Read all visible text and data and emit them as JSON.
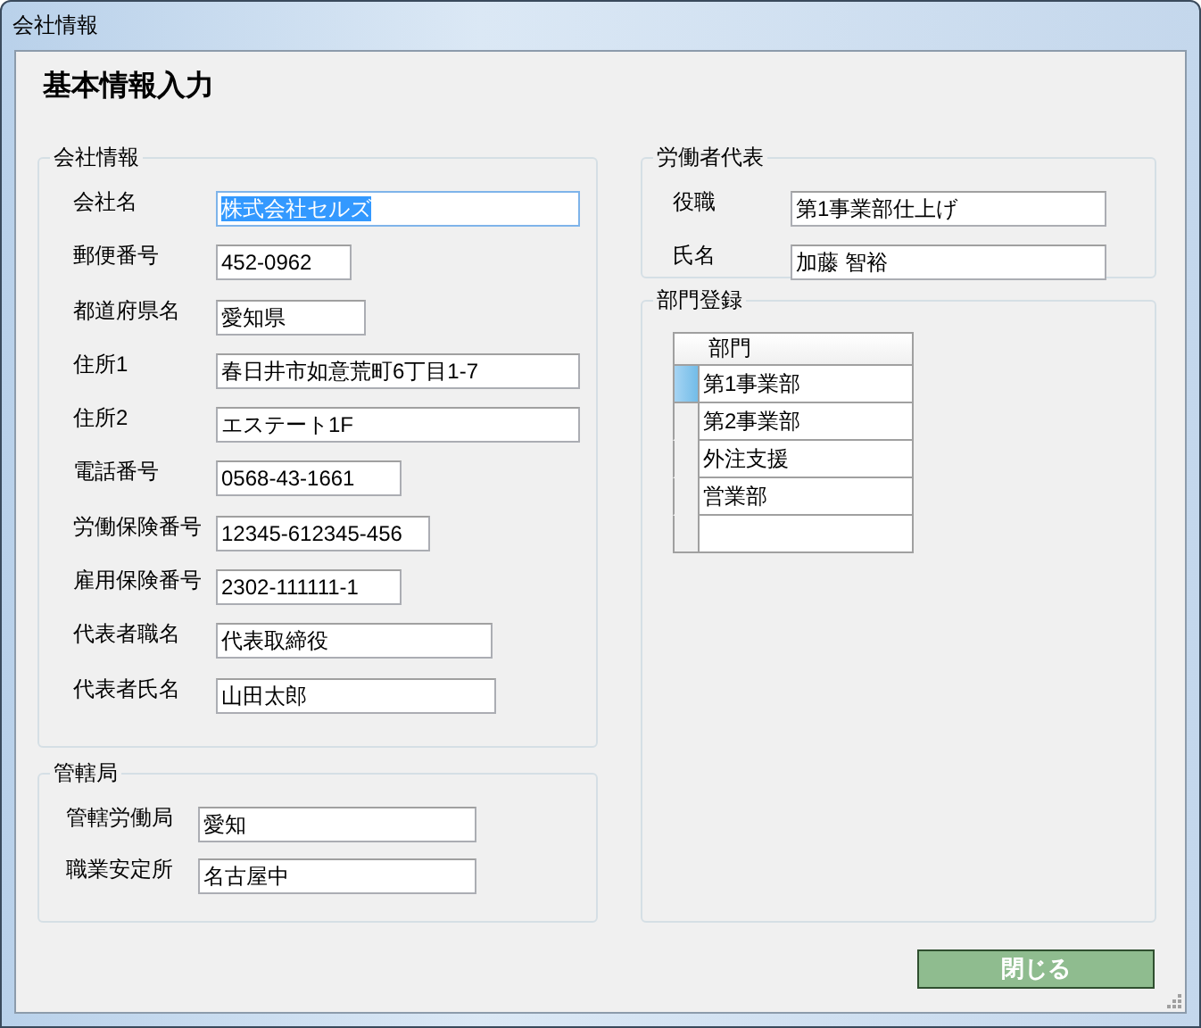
{
  "window": {
    "title": "会社情報"
  },
  "heading": "基本情報入力",
  "company": {
    "title": "会社情報",
    "fields": [
      {
        "label": "会社名",
        "value": "株式会社セルズ",
        "focused": true
      },
      {
        "label": "郵便番号",
        "value": "452-0962",
        "focused": false
      },
      {
        "label": "都道府県名",
        "value": "愛知県",
        "focused": false
      },
      {
        "label": "住所1",
        "value": "春日井市如意荒町6丁目1-7",
        "focused": false
      },
      {
        "label": "住所2",
        "value": "エステート1F",
        "focused": false
      },
      {
        "label": "電話番号",
        "value": "0568-43-1661",
        "focused": false
      },
      {
        "label": "労働保険番号",
        "value": "12345-612345-456",
        "focused": false
      },
      {
        "label": "雇用保険番号",
        "value": "2302-111111-1",
        "focused": false
      },
      {
        "label": "代表者職名",
        "value": "代表取締役",
        "focused": false
      },
      {
        "label": "代表者氏名",
        "value": "山田太郎",
        "focused": false
      }
    ]
  },
  "jurisdiction": {
    "title": "管轄局",
    "fields": [
      {
        "label": "管轄労働局",
        "value": "愛知",
        "focused": false
      },
      {
        "label": "職業安定所",
        "value": "名古屋中",
        "focused": false
      }
    ]
  },
  "worker_rep": {
    "title": "労働者代表",
    "fields": [
      {
        "label": "役職",
        "value": "第1事業部仕上げ",
        "focused": false
      },
      {
        "label": "氏名",
        "value": "加藤 智裕",
        "focused": false
      }
    ]
  },
  "departments": {
    "title": "部門登録",
    "column": "部門",
    "rows": [
      {
        "name": "第1事業部",
        "selected": true
      },
      {
        "name": "第2事業部",
        "selected": false
      },
      {
        "name": "外注支援",
        "selected": false
      },
      {
        "name": "営業部",
        "selected": false
      },
      {
        "name": "",
        "selected": false
      }
    ]
  },
  "close_button": "閉じる"
}
